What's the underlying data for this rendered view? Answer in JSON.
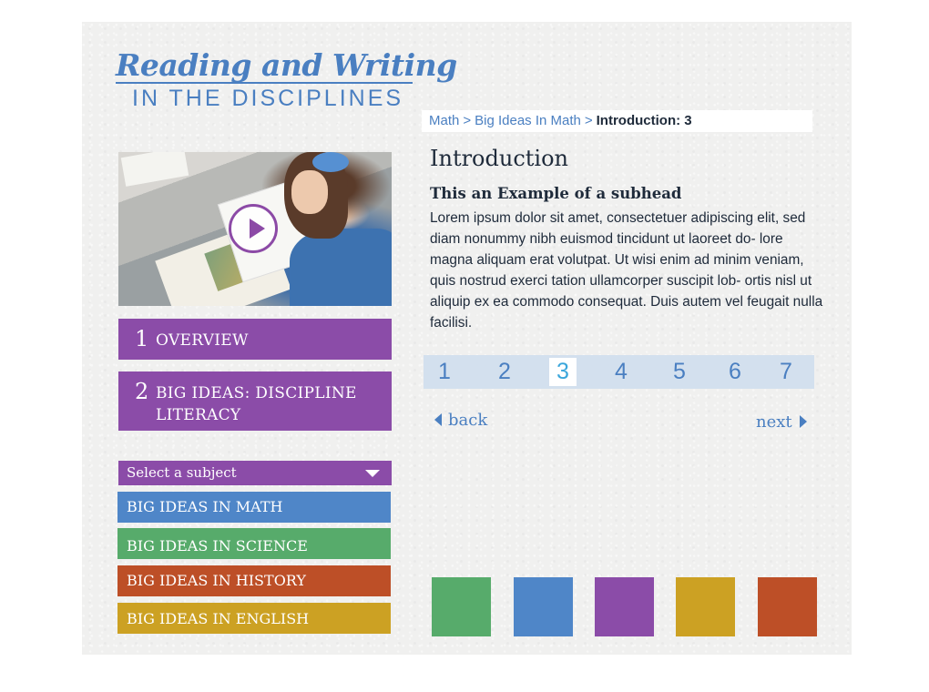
{
  "logo": {
    "title": "Reading and Writing",
    "subtitle": "IN THE DISCIPLINES"
  },
  "breadcrumb": {
    "items": [
      "Math",
      "Big Ideas In Math"
    ],
    "separator": ">",
    "current": "Introduction: 3"
  },
  "video": {
    "play_icon": "play-icon"
  },
  "sections": [
    {
      "number": "1",
      "label": "OVERVIEW"
    },
    {
      "number": "2",
      "label": "BIG IDEAS: DISCIPLINE LITERACY"
    }
  ],
  "subject_select": {
    "label": "Select a subject",
    "icon": "caret-down-icon"
  },
  "subjects": [
    {
      "label": "BIG IDEAS IN MATH",
      "color": "#4f86c8"
    },
    {
      "label": "BIG IDEAS IN SCIENCE",
      "color": "#57ab6b"
    },
    {
      "label": "BIG IDEAS IN HISTORY",
      "color": "#bd4f27"
    },
    {
      "label": "BIG IDEAS IN ENGLISH",
      "color": "#cca123"
    }
  ],
  "content": {
    "heading": "Introduction",
    "subhead": "This an Example of a subhead",
    "body": "Lorem ipsum dolor sit amet, consectetuer adipiscing elit, sed diam nonummy nibh euismod tincidunt ut laoreet do- lore magna aliquam erat volutpat. Ut wisi enim ad minim veniam, quis nostrud exerci tation ullamcorper suscipit lob- ortis nisl ut aliquip ex ea commodo consequat. Duis autem vel feugait nulla facilisi."
  },
  "pager": {
    "pages": [
      "1",
      "2",
      "3",
      "4",
      "5",
      "6",
      "7"
    ],
    "current_page": "3"
  },
  "navigation": {
    "back_label": "back",
    "next_label": "next"
  },
  "swatches": [
    "#57ab6b",
    "#4f86c8",
    "#8b4ca8",
    "#cca123",
    "#bd4f27"
  ],
  "colors": {
    "brand_blue": "#4a7fc1",
    "section_purple": "#8b4ca8",
    "pager_background": "#d3e0ee",
    "text_dark": "#1e2a3a"
  }
}
